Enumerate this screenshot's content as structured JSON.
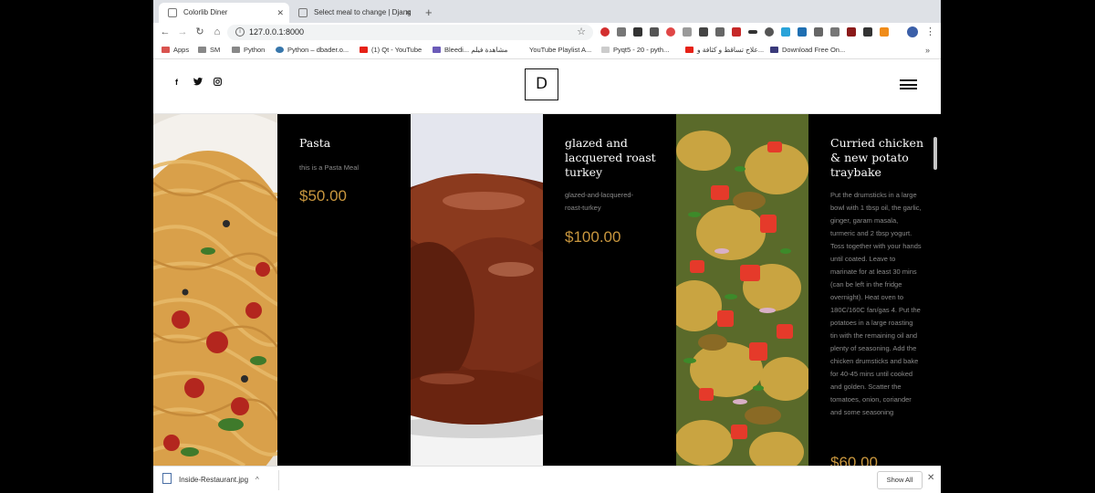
{
  "tabs": [
    {
      "title": "Colorlib Diner",
      "active": true
    },
    {
      "title": "Select meal to change | Djang",
      "active": false
    }
  ],
  "toolbar": {
    "url": "127.0.0.1:8000"
  },
  "bookmarks": {
    "items": [
      {
        "label": "Apps",
        "icon": "apps-grid-icon",
        "color": "#d9534f"
      },
      {
        "label": "SM",
        "icon": "folder-icon",
        "color": "#888888"
      },
      {
        "label": "Python",
        "icon": "folder-icon",
        "color": "#888888"
      },
      {
        "label": "Python – dbader.o...",
        "icon": "python-icon",
        "color": "#3776ab"
      },
      {
        "label": "(1) Qt - YouTube",
        "icon": "youtube-icon",
        "color": "#e62117"
      },
      {
        "label": "Bleedi... مشاهدة فيلم",
        "icon": "site-icon",
        "color": "#6b5bb8"
      },
      {
        "label": "YouTube Playlist A...",
        "icon": "page-icon",
        "color": "#ffffff"
      },
      {
        "label": "Pyqt5 - 20 - pyth...",
        "icon": "page-icon",
        "color": "#cccccc"
      },
      {
        "label": "علاج تساقط و كثافة و...",
        "icon": "youtube-icon",
        "color": "#e62117"
      },
      {
        "label": "Download Free On...",
        "icon": "bookmark-b-icon",
        "color": "#3a3a7a"
      }
    ],
    "more": "»"
  },
  "site": {
    "logo": "D"
  },
  "menu": [
    {
      "name": "Pasta",
      "description": "this is a Pasta Meal",
      "price": "$50.00"
    },
    {
      "name": "glazed and lacquered roast turkey",
      "description": "glazed-and-lacquered-roast-turkey",
      "price": "$100.00"
    },
    {
      "name": "Curried chicken & new potato traybake",
      "description": "Put the drumsticks in a large bowl with 1 tbsp oil, the garlic, ginger, garam masala, turmeric and 2 tbsp yogurt. Toss together with your hands until coated. Leave to marinate for at least 30 mins (can be left in the fridge overnight). Heat oven to 180C/160C fan/gas 4. Put the potatoes in a large roasting tin with the remaining oil and plenty of seasoning. Add the chicken drumsticks and bake for 40-45 mins until cooked and golden. Scatter the tomatoes, onion, coriander and some seasoning",
      "price": "$60.00"
    }
  ],
  "downloads": {
    "file": "Inside-Restaurant.jpg",
    "show_all": "Show All"
  },
  "colors": {
    "price": "#c8963e",
    "card_bg": "#000000",
    "header_bg": "#ffffff"
  }
}
